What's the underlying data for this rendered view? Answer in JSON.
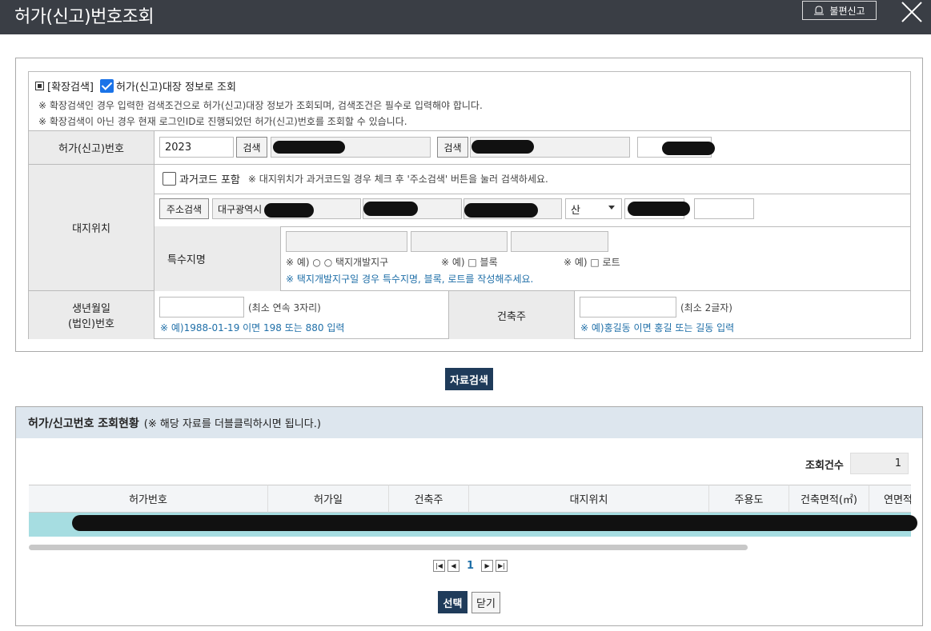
{
  "header": {
    "title": "허가(신고)번호조회",
    "report_label": "불편신고"
  },
  "search": {
    "extended_label": "[확장검색]",
    "ledger_checkbox_label": "허가(신고)대장 정보로 조회",
    "note1": "※ 확장검색인 경우 입력한 검색조건으로 허가(신고)대장 정보가 조회되며, 검색조건은 필수로 입력해야 합니다.",
    "note2": "※ 확장검색이 아닌 경우 현재 로그인ID로 진행되었던 허가(신고)번호를 조회할 수 있습니다.",
    "permit_no_label": "허가(신고)번호",
    "permit_year": "2023",
    "search_btn": "검색",
    "site_label": "대지위치",
    "past_code_label": "과거코드 포함",
    "past_code_note": "※ 대지위치가 과거코드일 경우 체크 후 '주소검색' 버튼을 눌러 검색하세요.",
    "addr_search_btn": "주소검색",
    "addr_city": "대구광역시",
    "mountain_select": "산",
    "special_label": "특수지명",
    "special_ex1": "※ 예) ○ ○ 택지개발지구",
    "special_ex2": "※ 예) □ 블록",
    "special_ex3": "※ 예) □ 로트",
    "special_note": "※ 택지개발지구일 경우 특수지명, 블록, 로트를 작성해주세요.",
    "birth_label1": "생년월일",
    "birth_label2": "(법인)번호",
    "birth_hint": "(최소 연속 3자리)",
    "birth_example": "※ 예)1988-01-19 이면 198 또는 880 입력",
    "owner_label": "건축주",
    "owner_hint": "(최소 2글자)",
    "owner_example": "※ 예)홍길동 이면 홍길 또는 길동 입력",
    "data_search_btn": "자료검색"
  },
  "result": {
    "title": "허가/신고번호 조회현황",
    "subtitle": "(※ 해당 자료를 더블클릭하시면 됩니다.)",
    "count_label": "조회건수",
    "count_value": "1",
    "columns": [
      "허가번호",
      "허가일",
      "건축주",
      "대지위치",
      "주용도",
      "건축면적(㎡)",
      "연면적"
    ],
    "page": "1",
    "select_btn": "선택",
    "close_btn": "닫기"
  }
}
